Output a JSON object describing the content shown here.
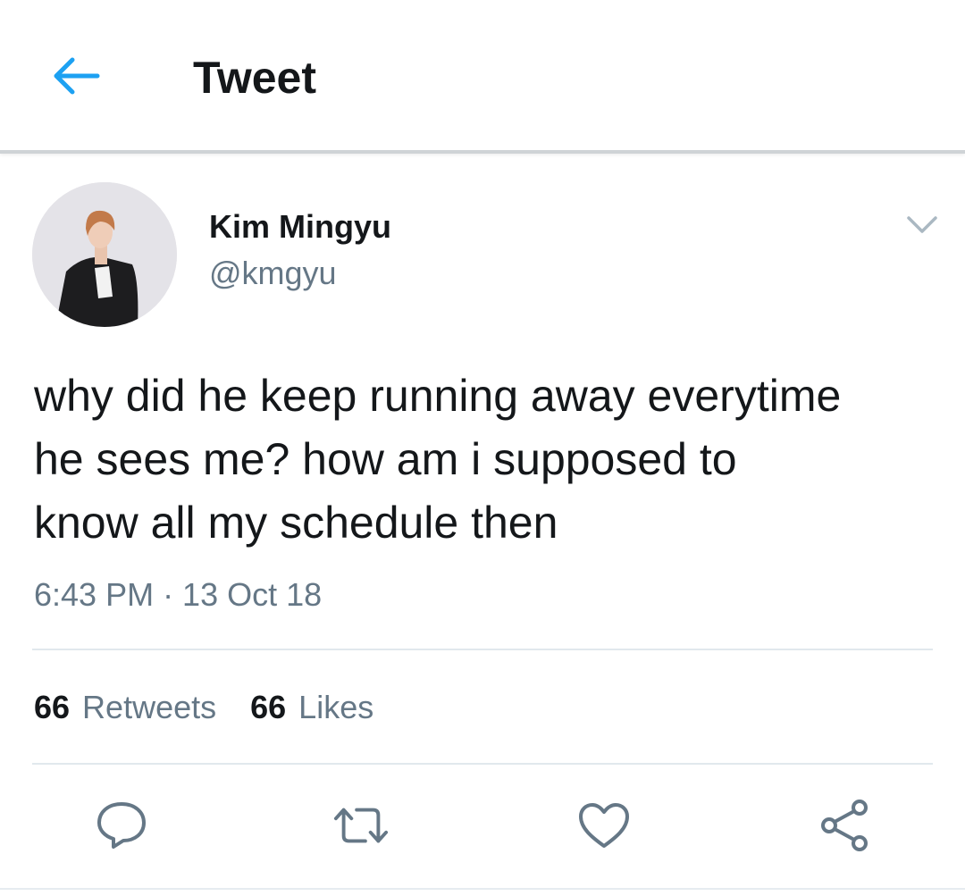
{
  "header": {
    "back_icon": "arrow-left-icon",
    "title": "Tweet",
    "accent_color": "#1da1f2"
  },
  "author": {
    "name": "Kim Mingyu",
    "handle": "@kmgyu",
    "avatar_icon": "profile-photo",
    "menu_icon": "chevron-down-icon"
  },
  "tweet": {
    "text": "why did he keep running away everytime\nhe sees me? how am i supposed to\nknow all my schedule then",
    "timestamp": "6:43 PM · 13 Oct 18"
  },
  "stats": {
    "retweets_count": "66",
    "retweets_label": "Retweets",
    "likes_count": "66",
    "likes_label": "Likes"
  },
  "actions": {
    "reply_icon": "reply-icon",
    "retweet_icon": "retweet-icon",
    "like_icon": "heart-icon",
    "share_icon": "share-icon",
    "icon_color": "#657786"
  }
}
